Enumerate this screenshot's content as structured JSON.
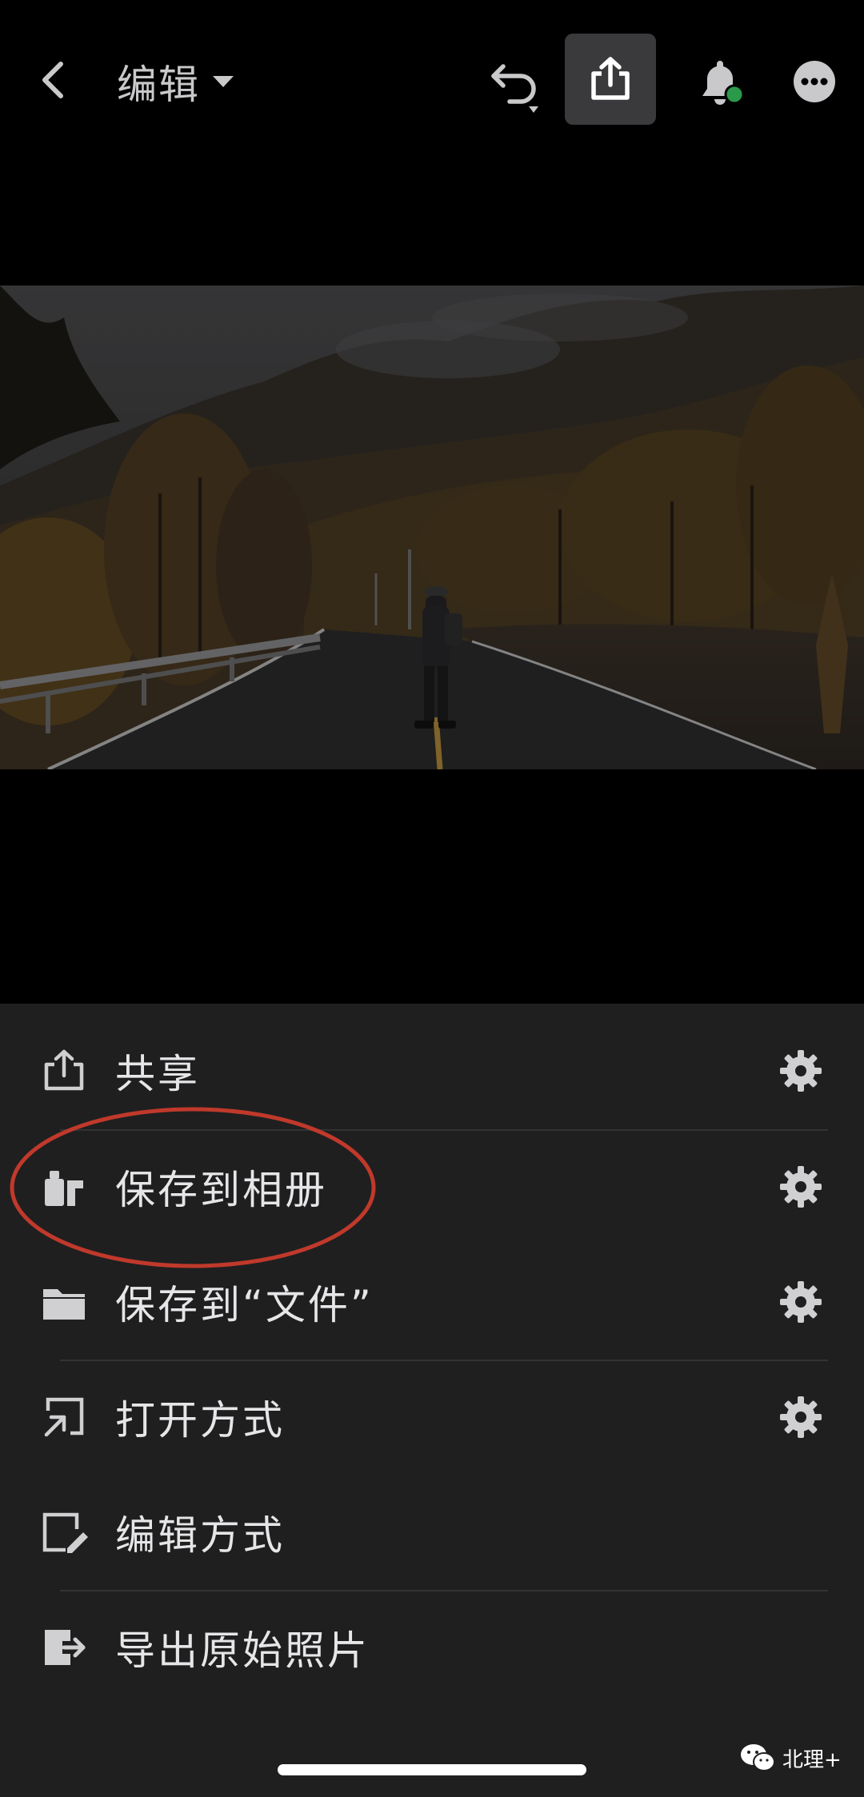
{
  "header": {
    "title": "编辑",
    "back_icon": "chevron-left-icon",
    "dropdown_icon": "caret-down-icon",
    "undo_icon": "undo-icon",
    "share_icon": "share-icon",
    "notification_icon": "bell-icon",
    "more_icon": "more-icon",
    "notification_dot_color": "#2a9a4a"
  },
  "menu": {
    "items": [
      {
        "label": "共享",
        "icon": "share-icon",
        "has_settings": true
      },
      {
        "label": "保存到相册",
        "icon": "camera-roll-icon",
        "has_settings": true
      },
      {
        "label": "保存到“文件”",
        "icon": "folder-icon",
        "has_settings": true
      },
      {
        "label": "打开方式",
        "icon": "open-in-icon",
        "has_settings": true
      },
      {
        "label": "编辑方式",
        "icon": "edit-in-icon",
        "has_settings": false
      },
      {
        "label": "导出原始照片",
        "icon": "export-original-icon",
        "has_settings": false
      }
    ],
    "settings_icon": "gear-icon"
  },
  "annotation_color": "#c0392b",
  "watermark": {
    "text": "北理+",
    "icon": "wechat-icon"
  }
}
